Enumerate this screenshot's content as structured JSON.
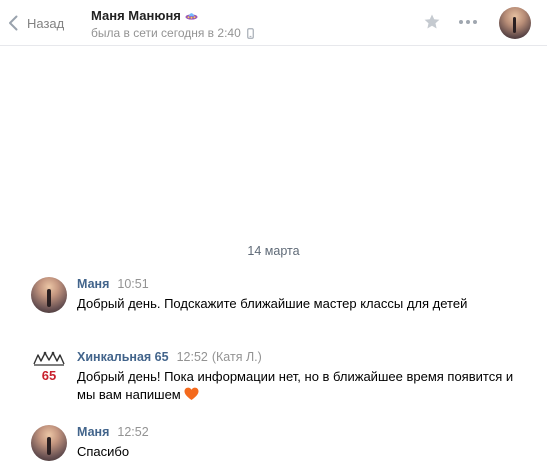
{
  "header": {
    "back_label": "Назад",
    "peer_name": "Маня Манюня",
    "peer_status": "была в сети сегодня в 2:40",
    "icons": [
      "chevron-left-icon",
      "ufo-emoji-icon",
      "mobile-phone-icon",
      "star-icon",
      "more-icon"
    ]
  },
  "history": {
    "date_separator": "14 марта",
    "messages": [
      {
        "author": "Маня",
        "time": "10:51",
        "signer": "",
        "text": "Добрый день. Подскажите ближайшие мастер классы для детей"
      },
      {
        "author": "Хинкальная 65",
        "time": "12:52",
        "signer": "(Катя Л.)",
        "text": "Добрый день! Пока информации нет, но в ближайшее время появится и мы вам напишем",
        "logo_text": "65"
      },
      {
        "author": "Маня",
        "time": "12:52",
        "signer": "",
        "text": "Спасибо"
      }
    ]
  },
  "colors": {
    "author_link": "#42648b",
    "meta_gray": "#939393",
    "logo_red": "#c8202c",
    "heart": "#f46a1d"
  }
}
